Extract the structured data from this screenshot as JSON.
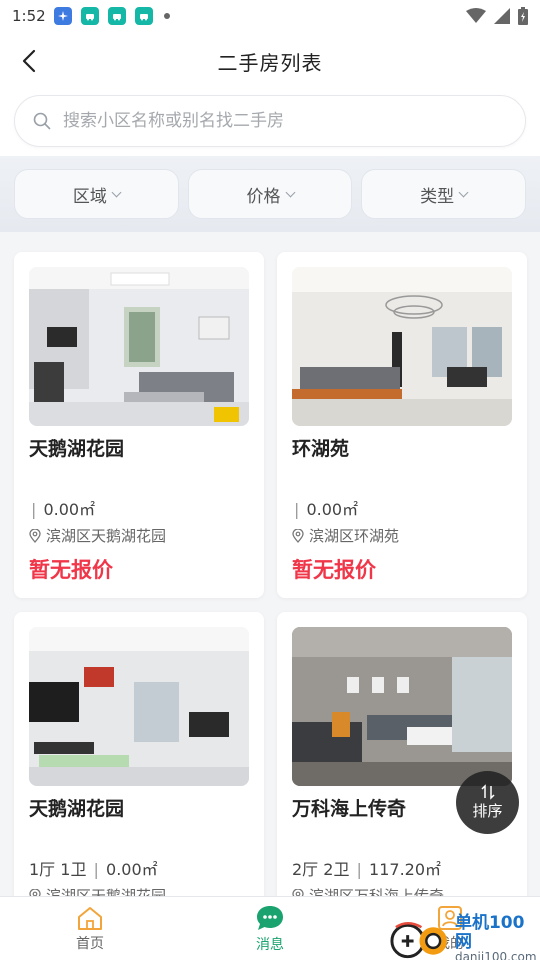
{
  "status_bar": {
    "time": "1:52"
  },
  "nav": {
    "title": "二手房列表"
  },
  "search": {
    "placeholder": "搜索小区名称或别名找二手房"
  },
  "filters": [
    {
      "label": "区域"
    },
    {
      "label": "价格"
    },
    {
      "label": "类型"
    }
  ],
  "listings": [
    {
      "title": "天鹅湖花园",
      "layout": "",
      "area": "0.00㎡",
      "address": "滨湖区天鹅湖花园",
      "price": "暂无报价"
    },
    {
      "title": "环湖苑",
      "layout": "",
      "area": "0.00㎡",
      "address": "滨湖区环湖苑",
      "price": "暂无报价"
    },
    {
      "title": "天鹅湖花园",
      "layout": "1厅 1卫",
      "area": "0.00㎡",
      "address": "滨湖区天鹅湖花园",
      "price": ""
    },
    {
      "title": "万科海上传奇",
      "layout": "2厅 2卫",
      "area": "117.20㎡",
      "address": "滨湖区万科海上传奇",
      "price": ""
    }
  ],
  "sort_button": {
    "label": "排序"
  },
  "tabs": [
    {
      "label": "首页"
    },
    {
      "label": "消息"
    },
    {
      "label": "我的"
    }
  ],
  "watermark": {
    "cn": "单机100网",
    "en": "danji100.com"
  },
  "colors": {
    "price": "#f0374a",
    "active_tab": "#1aa36e",
    "accent_blue": "#3d7be0"
  }
}
